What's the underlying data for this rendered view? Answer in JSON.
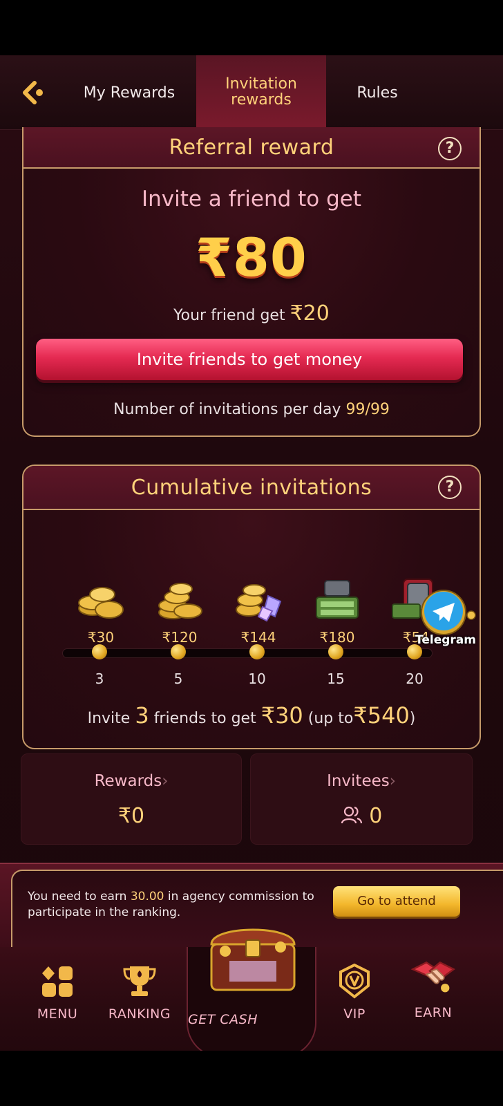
{
  "tabs": {
    "my_rewards": "My Rewards",
    "invitation_rewards_line1": "Invitation",
    "invitation_rewards_line2": "rewards",
    "rules": "Rules"
  },
  "referral": {
    "title": "Referral reward",
    "invite_label": "Invite a friend to get",
    "amount": "₹80",
    "friend_get_label": "Your friend get",
    "friend_get_amount": "₹20",
    "invite_button": "Invite friends to get money",
    "per_day_label": "Number of invitations per day",
    "per_day_value": "99/99"
  },
  "cumulative": {
    "title": "Cumulative invitations",
    "tiers": [
      {
        "amount": "₹30",
        "count": "3"
      },
      {
        "amount": "₹120",
        "count": "5"
      },
      {
        "amount": "₹144",
        "count": "10"
      },
      {
        "amount": "₹180",
        "count": "15"
      },
      {
        "amount": "₹54",
        "count": "20"
      }
    ],
    "note_prefix": "Invite",
    "note_count": "3",
    "note_mid": "friends to get",
    "note_amount": "₹30",
    "note_up_to_label": "(up to",
    "note_up_to_amount": "₹540",
    "note_close": ")"
  },
  "telegram": {
    "label": "Telegram"
  },
  "stats": {
    "rewards_label": "Rewards",
    "rewards_value": "₹0",
    "invitees_label": "Invitees",
    "invitees_value": "0"
  },
  "ranking": {
    "text_prefix": "You need to earn",
    "text_amount": "30.00",
    "text_suffix": "in agency commission to participate in the ranking.",
    "button": "Go to attend"
  },
  "nav": {
    "menu": "MENU",
    "ranking": "RANKING",
    "get_cash": "GET CASH",
    "vip": "VIP",
    "earn": "EARN"
  },
  "colors": {
    "gold": "#ffd27a",
    "pink_text": "#f7b8c8",
    "button_red": "#e52a52",
    "border_gold": "#c79b6a"
  }
}
